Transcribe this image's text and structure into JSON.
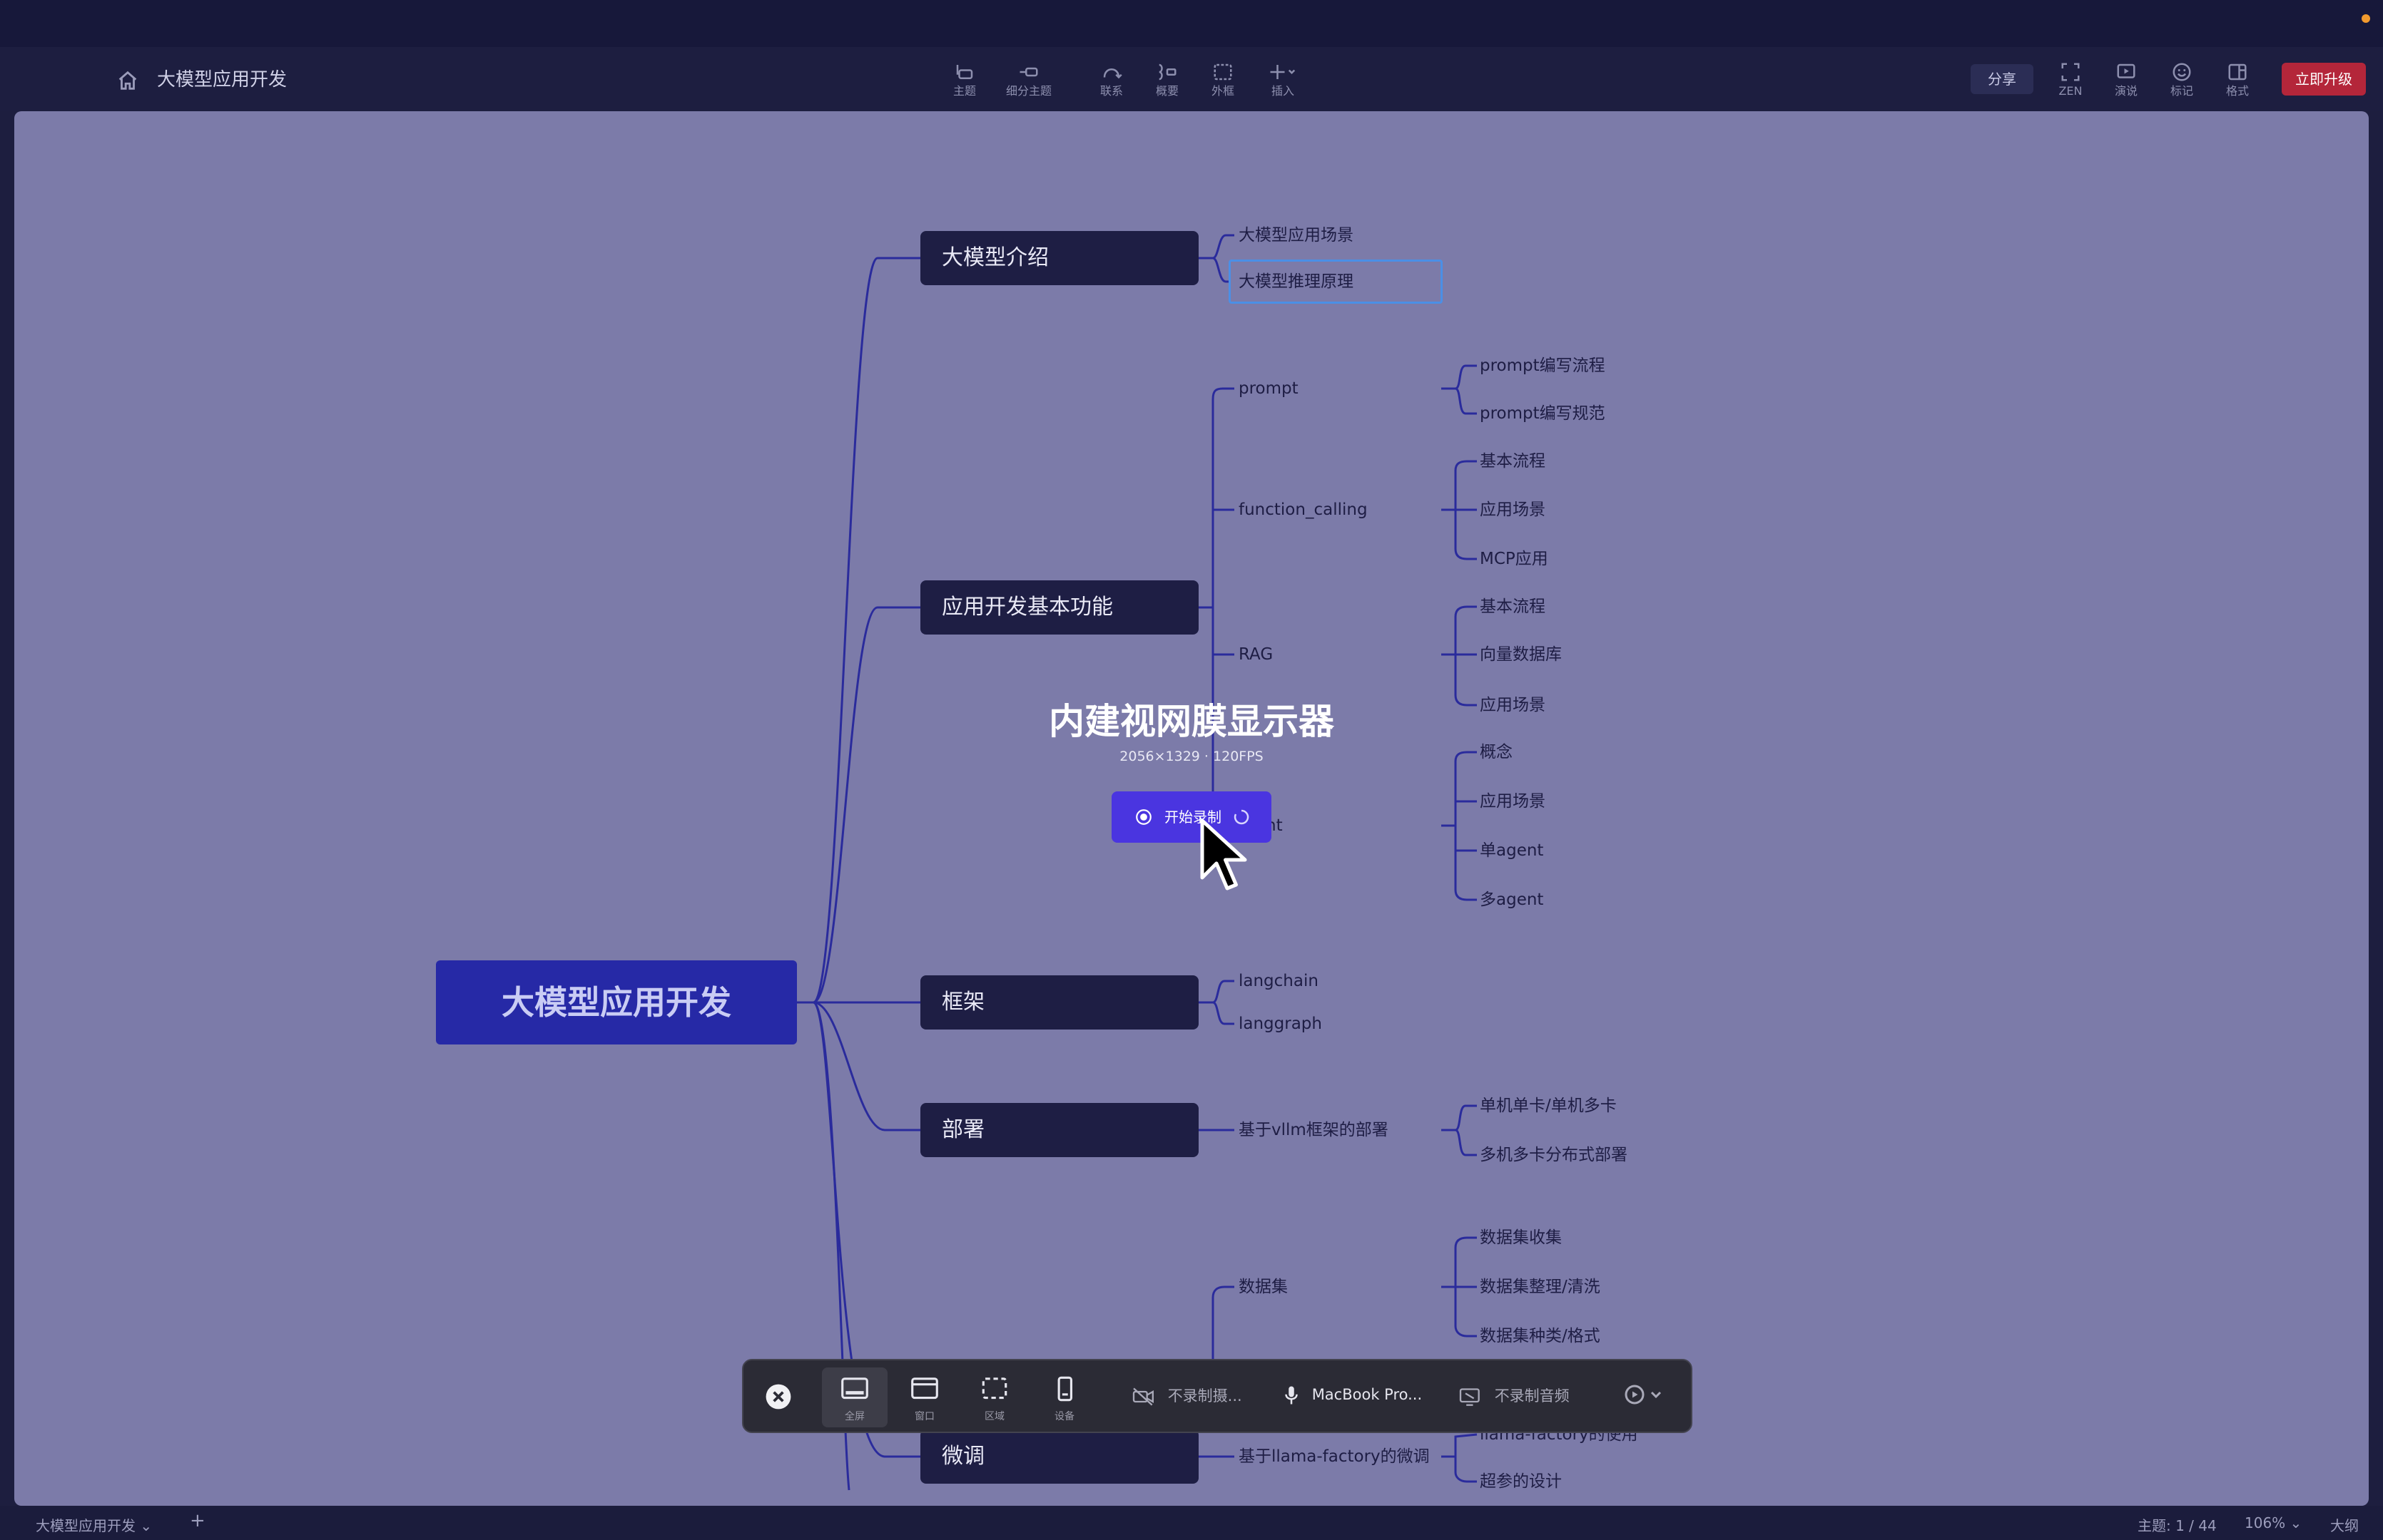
{
  "window": {
    "title": "大模型应用开发"
  },
  "toolbar": {
    "tools": [
      {
        "label": "主题",
        "icon": "topic-icon"
      },
      {
        "label": "细分主题",
        "icon": "subtopic-icon"
      },
      {
        "label": "联系",
        "icon": "relationship-icon"
      },
      {
        "label": "概要",
        "icon": "summary-icon"
      },
      {
        "label": "外框",
        "icon": "boundary-icon"
      },
      {
        "label": "插入",
        "icon": "insert-icon"
      }
    ],
    "right_tools": [
      {
        "label": "ZEN",
        "icon": "zen-icon"
      },
      {
        "label": "演说",
        "icon": "pitch-icon"
      },
      {
        "label": "标记",
        "icon": "marker-icon"
      },
      {
        "label": "格式",
        "icon": "format-icon"
      }
    ],
    "share_label": "分享",
    "upgrade_label": "立即升级"
  },
  "mindmap": {
    "root": "大模型应用开发",
    "branches": [
      {
        "label": "大模型介绍",
        "children": [
          "大模型应用场景",
          "大模型推理原理"
        ]
      },
      {
        "label": "应用开发基本功能",
        "children": [
          {
            "label": "prompt",
            "children": [
              "prompt编写流程",
              "prompt编写规范"
            ]
          },
          {
            "label": "function_calling",
            "children": [
              "基本流程",
              "应用场景",
              "MCP应用"
            ]
          },
          {
            "label": "RAG",
            "children": [
              "基本流程",
              "向量数据库",
              "应用场景"
            ]
          },
          {
            "label": "nt",
            "children": [
              "概念",
              "应用场景",
              "单agent",
              "多agent"
            ]
          }
        ]
      },
      {
        "label": "框架",
        "children": [
          "langchain",
          "langgraph"
        ]
      },
      {
        "label": "部署",
        "children": [
          {
            "label": "基于vllm框架的部署",
            "children": [
              "单机单卡/单机多卡",
              "多机多卡分布式部署"
            ]
          }
        ]
      },
      {
        "label": "微调",
        "children": [
          {
            "label": "数据集",
            "children": [
              "数据集收集",
              "数据集整理/清洗",
              "数据集种类/格式"
            ]
          },
          {
            "label": "基于llama-factory的微调",
            "children": [
              "llama-factory的使用",
              "超参的设计"
            ]
          }
        ]
      }
    ]
  },
  "overlay": {
    "display_name": "内建视网膜显示器",
    "display_spec": "2056×1329 · 120FPS",
    "record_label": "开始录制"
  },
  "recorder_bar": {
    "modes": [
      {
        "label": "全屏",
        "icon": "fullscreen-icon",
        "active": true
      },
      {
        "label": "窗口",
        "icon": "window-icon",
        "active": false
      },
      {
        "label": "区域",
        "icon": "region-icon",
        "active": false
      },
      {
        "label": "设备",
        "icon": "device-icon",
        "active": false
      }
    ],
    "camera_label": "不录制摄...",
    "mic_label": "MacBook Pro...",
    "audio_label": "不录制音频"
  },
  "statusbar": {
    "sheet_tab": "大模型应用开发",
    "topic_count": "主题: 1 / 44",
    "zoom": "106%",
    "outline_label": "大纲"
  },
  "colors": {
    "canvas": "#7c7ba9",
    "node": "#1e1e44",
    "root": "#2629a6",
    "line": "#2a2b9c",
    "accent": "#4a35e0",
    "upgrade": "#b4263a"
  }
}
